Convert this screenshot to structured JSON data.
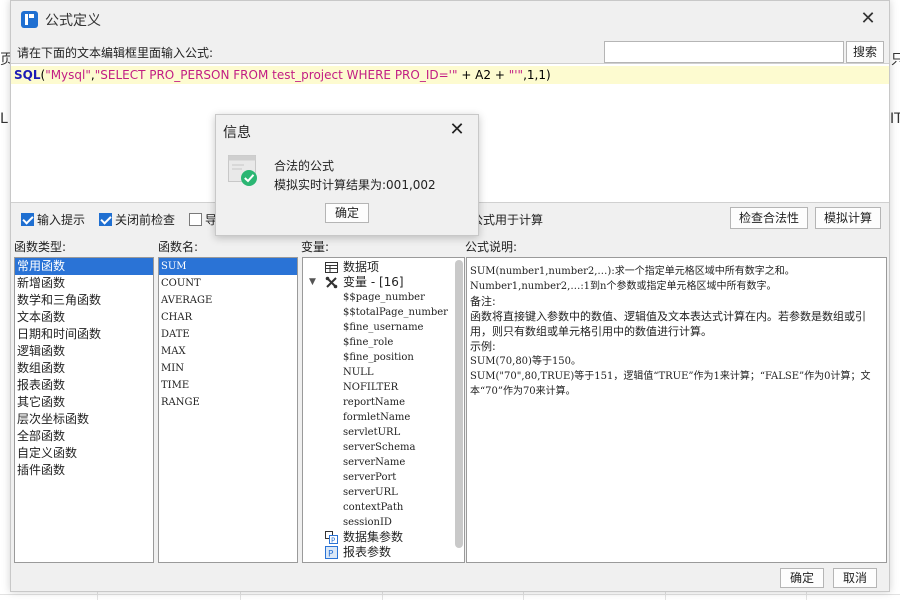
{
  "background": {
    "left_edge_chars": [
      "页",
      "L"
    ],
    "right_edge_chars": [
      "只",
      "IT"
    ]
  },
  "dialog": {
    "title": "公式定义",
    "prompt": "请在下面的文本编辑框里面输入公式:",
    "search": {
      "value": "",
      "button": "搜索"
    },
    "formula": {
      "tokens": [
        {
          "t": "SQL",
          "k": "fn"
        },
        {
          "t": "(",
          "k": "plain"
        },
        {
          "t": "\"Mysql\"",
          "k": "str"
        },
        {
          "t": ",",
          "k": "plain"
        },
        {
          "t": "\"SELECT PRO_PERSON FROM test_project WHERE PRO_ID='\"",
          "k": "str"
        },
        {
          "t": " + A2 + ",
          "k": "plain"
        },
        {
          "t": "\"'\"",
          "k": "str"
        },
        {
          "t": ",1,1)",
          "k": "plain"
        }
      ]
    },
    "options": {
      "input_hint": {
        "label": "输入提示",
        "checked": true
      },
      "check_before_close": {
        "label": "关闭前检查",
        "checked": true
      },
      "import_partial": {
        "label": "导",
        "checked": false
      },
      "hidden_text": "公式用于计算"
    },
    "buttons": {
      "check_validity": "检查合法性",
      "simulate": "模拟计算",
      "ok": "确定",
      "cancel": "取消"
    },
    "columns": {
      "categories_label": "函数类型:",
      "functions_label": "函数名:",
      "variables_label": "变量:",
      "description_label": "公式说明:"
    },
    "categories": [
      "常用函数",
      "新增函数",
      "数学和三角函数",
      "文本函数",
      "日期和时间函数",
      "逻辑函数",
      "数组函数",
      "报表函数",
      "其它函数",
      "层次坐标函数",
      "全部函数",
      "自定义函数",
      "插件函数"
    ],
    "selected_category": 0,
    "functions": [
      "SUM",
      "COUNT",
      "AVERAGE",
      "CHAR",
      "DATE",
      "MAX",
      "MIN",
      "TIME",
      "RANGE"
    ],
    "selected_function": 0,
    "variables": {
      "data_items": "数据项",
      "var_group": "变量 - [16]",
      "leaves": [
        "$$page_number",
        "$$totalPage_number",
        "$fine_username",
        "$fine_role",
        "$fine_position",
        "NULL",
        "NOFILTER",
        "reportName",
        "formletName",
        "servletURL",
        "serverSchema",
        "serverName",
        "serverPort",
        "serverURL",
        "contextPath",
        "sessionID"
      ],
      "dataset_params": "数据集参数",
      "report_params": "报表参数"
    },
    "description": {
      "l1": "SUM(number1,number2,…):求一个指定单元格区域中所有数字之和。",
      "l2": "Number1,number2,…:1到n个参数或指定单元格区域中所有数字。",
      "l3": "备注:",
      "l4": "函数将直接键入参数中的数值、逻辑值及文本表达式计算在内。若参数是数组或引用，则只有数组或单元格引用中的数值进行计算。",
      "l5": "示例:",
      "l6": "SUM(70,80)等于150。",
      "l7": "SUM(\"70\",80,TRUE)等于151，逻辑值“TRUE”作为1来计算；“FALSE”作为0计算；文本“70”作为70来计算。"
    }
  },
  "popup": {
    "title": "信息",
    "message1": "合法的公式",
    "message2": "模拟实时计算结果为:001,002",
    "ok": "确定"
  },
  "colors": {
    "accent": "#2a73d6",
    "highlight_line": "#fdfbd0",
    "success": "#2bb673"
  }
}
